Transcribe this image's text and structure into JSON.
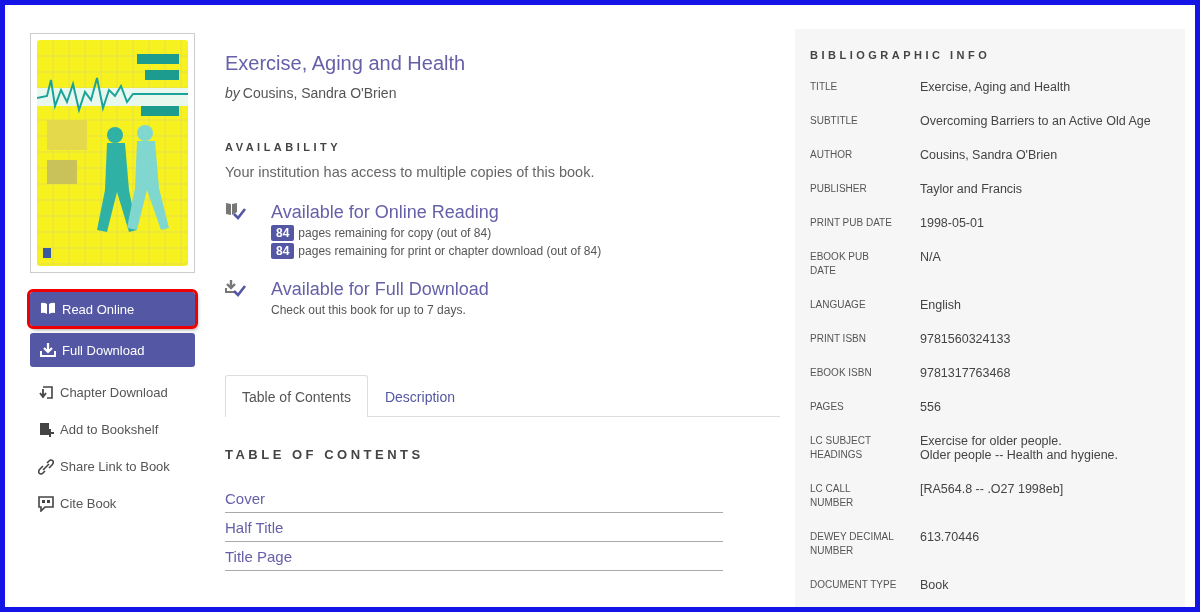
{
  "actions": [
    {
      "kind": "button",
      "label": "Read Online",
      "highlighted": true
    },
    {
      "kind": "button",
      "label": "Full Download",
      "highlighted": false
    },
    {
      "kind": "link",
      "label": "Chapter Download",
      "highlighted": false
    },
    {
      "kind": "link",
      "label": "Add to Bookshelf",
      "highlighted": false
    },
    {
      "kind": "link",
      "label": "Share Link to Book",
      "highlighted": false
    },
    {
      "kind": "link",
      "label": "Cite Book",
      "highlighted": false
    }
  ],
  "book": {
    "title": "Exercise, Aging and Health",
    "by": "by",
    "author": "Cousins, Sandra O'Brien"
  },
  "availability": {
    "heading": "AVAILABILITY",
    "note": "Your institution has access to multiple copies of this book.",
    "options": [
      {
        "title": "Available for Online Reading",
        "lines": [
          {
            "count": "84",
            "text": "pages remaining for copy (out of 84)"
          },
          {
            "count": "84",
            "text": "pages remaining for print or chapter download (out of 84)"
          }
        ]
      },
      {
        "title": "Available for Full Download",
        "note": "Check out this book for up to 7 days."
      }
    ]
  },
  "tabs": [
    {
      "label": "Table of Contents",
      "selected": true
    },
    {
      "label": "Description",
      "selected": false
    }
  ],
  "toc": {
    "heading": "TABLE OF CONTENTS",
    "items": [
      "Cover",
      "Half Title",
      "Title Page"
    ]
  },
  "biblio": {
    "heading": "BIBLIOGRAPHIC INFO",
    "rows": [
      {
        "label": "TITLE",
        "values": [
          "Exercise, Aging and Health"
        ]
      },
      {
        "label": "SUBTITLE",
        "values": [
          "Overcoming Barriers to an Active Old Age"
        ]
      },
      {
        "label": "AUTHOR",
        "values": [
          "Cousins, Sandra O'Brien"
        ]
      },
      {
        "label": "PUBLISHER",
        "values": [
          "Taylor and Francis"
        ]
      },
      {
        "label": "PRINT PUB DATE",
        "values": [
          "1998-05-01"
        ]
      },
      {
        "label": "EBOOK PUB\nDATE",
        "values": [
          "N/A"
        ]
      },
      {
        "label": "LANGUAGE",
        "values": [
          "English"
        ]
      },
      {
        "label": "PRINT ISBN",
        "values": [
          "9781560324133"
        ]
      },
      {
        "label": "EBOOK ISBN",
        "values": [
          "9781317763468"
        ]
      },
      {
        "label": "PAGES",
        "values": [
          "556"
        ]
      },
      {
        "label": "LC SUBJECT\nHEADINGS",
        "values": [
          "Exercise for older people.",
          "Older people -- Health and hygiene."
        ]
      },
      {
        "label": "LC CALL\nNUMBER",
        "values": [
          "[RA564.8 -- .O27 1998eb]"
        ]
      },
      {
        "label": "DEWEY DECIMAL\nNUMBER",
        "values": [
          "613.70446"
        ]
      },
      {
        "label": "DOCUMENT TYPE",
        "values": [
          "Book"
        ]
      }
    ]
  }
}
